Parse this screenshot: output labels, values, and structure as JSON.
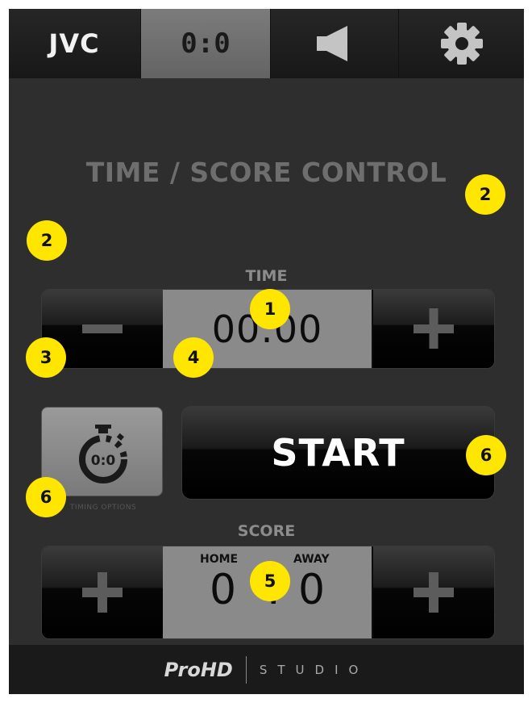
{
  "tabs": {
    "brand": "JVC",
    "score": "0:0",
    "audio_icon": "speaker-icon",
    "settings_icon": "gear-icon"
  },
  "page_title": "TIME / SCORE CONTROL",
  "time": {
    "label": "TIME",
    "value": "00:00",
    "decrement_icon": "minus-icon",
    "increment_icon": "plus-icon"
  },
  "timing_options": {
    "icon": "stopwatch-icon",
    "icon_text": "0:0",
    "label": "TIMING OPTIONS"
  },
  "start_label": "START",
  "score": {
    "label": "SCORE",
    "home_label": "HOME",
    "away_label": "AWAY",
    "home_value": "0",
    "away_value": "0",
    "home_icon": "plus-icon",
    "away_icon": "plus-icon"
  },
  "footer": {
    "brand": "ProHD",
    "product": "STUDIO"
  },
  "markers": [
    "1",
    "2",
    "2",
    "3",
    "4",
    "5",
    "6",
    "6"
  ],
  "colors": {
    "marker": "#ffe600",
    "background": "#2e2e2e",
    "active_tab": "#6f6f6f"
  }
}
